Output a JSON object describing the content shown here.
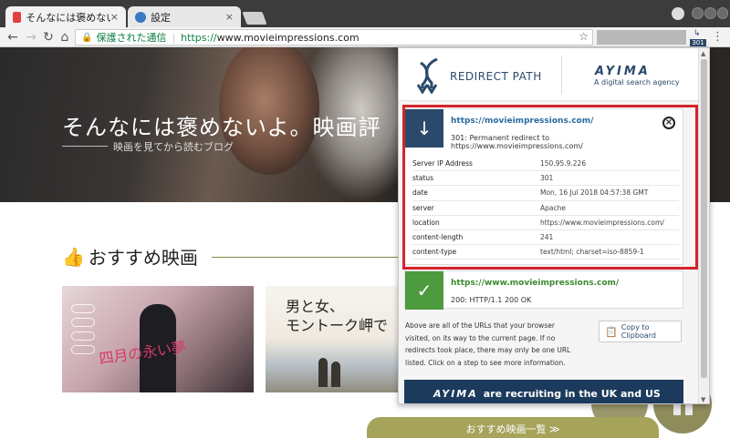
{
  "browser": {
    "tabs": [
      {
        "title": "そんなには褒めないよ。",
        "close": "×"
      },
      {
        "title": "設定",
        "close": "×"
      }
    ],
    "omnibox": {
      "secure_label": "保護された通信",
      "url_scheme": "https://",
      "url_host": "www.movieimpressions.com"
    },
    "extension_badge": "301"
  },
  "page": {
    "hero_title": "そんなには褒めないよ。映画評",
    "hero_subtitle": "映画を見てから読むブログ",
    "section_title": "おすすめ映画",
    "poster1_script": "四月の永い夢",
    "poster2_title_line1": "男と女、",
    "poster2_title_line2": "モントーク岬で",
    "more_button": "おすすめ映画一覧 ≫"
  },
  "popup": {
    "brand_name": "REDIRECT PATH",
    "partner_name": "AYIMA",
    "partner_tagline": "A digital search agency",
    "hops": [
      {
        "url": "https://movieimpressions.com/",
        "status": "301: Permanent redirect to https://www.movieimpressions.com/",
        "headers": [
          {
            "key": "Server IP Address",
            "value": "150.95.9.226"
          },
          {
            "key": "status",
            "value": "301"
          },
          {
            "key": "date",
            "value": "Mon, 16 Jul 2018 04:57:38 GMT"
          },
          {
            "key": "server",
            "value": "Apache"
          },
          {
            "key": "location",
            "value": "https://www.movieimpressions.com/"
          },
          {
            "key": "content-length",
            "value": "241"
          },
          {
            "key": "content-type",
            "value": "text/html; charset=iso-8859-1"
          }
        ]
      },
      {
        "url": "https://www.movieimpressions.com/",
        "status": "200: HTTP/1.1 200 OK"
      }
    ],
    "info_text": "Above are all of the URLs that your browser visited, on its way to the current page. If no redirects took place, there may only be one URL listed. Click on a step to see more information.",
    "copy_button": "Copy to Clipboard",
    "banner_logo": "AYIMA",
    "banner_text": "are recruiting in the UK and US"
  },
  "colors": {
    "brand_blue": "#2b4a6b",
    "success_green": "#4e9a3e",
    "highlight_red": "#d4232b",
    "olive": "#a6a35a"
  }
}
